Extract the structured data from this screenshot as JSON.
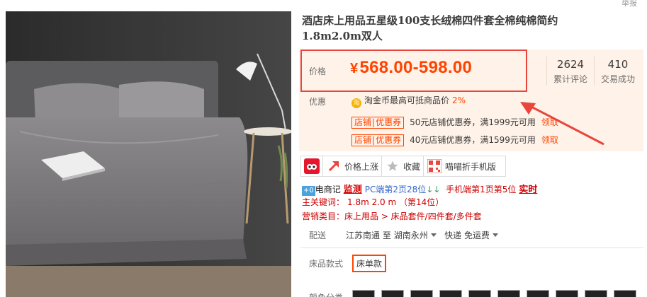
{
  "header": {
    "report_label": "举报"
  },
  "product": {
    "title_line1": "酒店床上用品五星级100支长绒棉四件套全棉纯棉简约",
    "title_line2": "1.8m2.0m双人"
  },
  "price": {
    "label": "价格",
    "currency": "¥",
    "value": "568.00-598.00"
  },
  "stats": [
    {
      "value": "2624",
      "label": "累计评论"
    },
    {
      "value": "410",
      "label": "交易成功"
    }
  ],
  "promo": {
    "label": "优惠",
    "coin_icon": "淘",
    "coin_text": "淘金币最高可抵商品价",
    "coin_percent": "2%",
    "coupons": [
      {
        "tag_left": "店铺",
        "tag_right": "优惠券",
        "desc": "50元店铺优惠券，满1999元可用",
        "action": "领取"
      },
      {
        "tag_left": "店铺",
        "tag_right": "优惠券",
        "desc": "40元店铺优惠券，满1599元可用",
        "action": "领取"
      }
    ]
  },
  "share": {
    "price_up": "价格上涨",
    "favorite": "收藏",
    "mobile": "喵喵折手机版"
  },
  "dianshangji": {
    "logo": "+0",
    "name": "电商记",
    "monitor": "监测",
    "pc_rank": "PC端第2页28位",
    "pc_arrow": "↓↓",
    "mobile_rank": "手机端第1页第5位",
    "realtime": "实时"
  },
  "keyword": {
    "label": "主关键词：",
    "value": "1.8m 2.0 m （第14位）"
  },
  "category": {
    "text": "营销类目：床上用品 > 床品套件/四件套/多件套"
  },
  "shipping": {
    "label": "配送",
    "from": "江苏南通",
    "to_word": "至",
    "to": "湖南永州",
    "express": "快递 免运费"
  },
  "style": {
    "label": "床品款式",
    "option": "床单款"
  },
  "color": {
    "label": "颜色分类"
  },
  "colors": {
    "accent": "#ff4400",
    "price_border": "#e8453c",
    "panel_bg": "#fff2e8"
  }
}
